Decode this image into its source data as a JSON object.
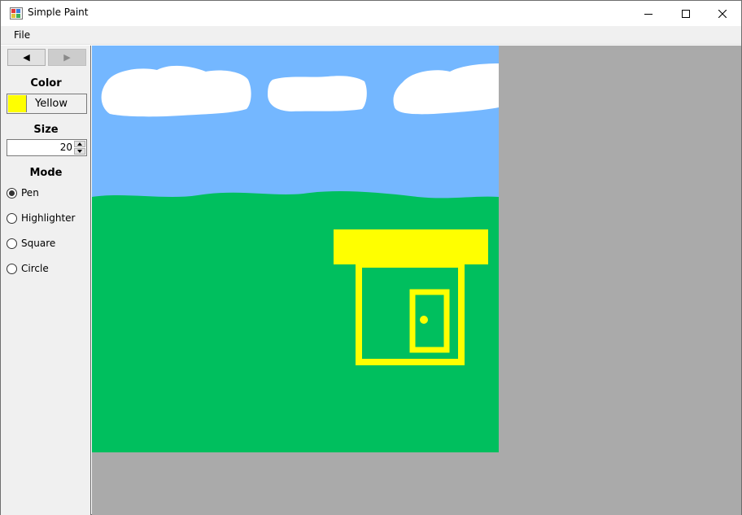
{
  "window": {
    "title": "Simple Paint"
  },
  "menu": {
    "items": [
      "File"
    ]
  },
  "toolbar": {
    "back_glyph": "◀",
    "forward_glyph": "▶"
  },
  "panel": {
    "color_label": "Color",
    "color_name": "Yellow",
    "color_value": "#ffff00",
    "size_label": "Size",
    "size_value": "20",
    "mode_label": "Mode",
    "modes": [
      {
        "label": "Pen",
        "checked": true
      },
      {
        "label": "Highlighter",
        "checked": false
      },
      {
        "label": "Square",
        "checked": false
      },
      {
        "label": "Circle",
        "checked": false
      }
    ]
  },
  "canvas": {
    "sky_color": "#74b7ff",
    "grass_color": "#00bf5e",
    "cloud_color": "#ffffff",
    "house_color": "#ffff00",
    "workspace_color": "#aaaaaa"
  }
}
